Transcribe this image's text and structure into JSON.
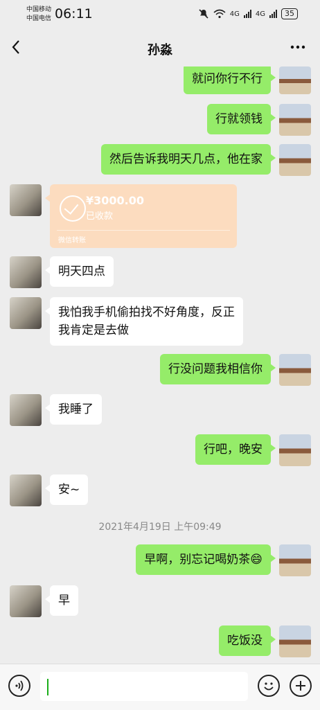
{
  "status_bar": {
    "carrier_1": "中国移动",
    "carrier_2": "中国电信",
    "time": "06:11",
    "net_1": "4G",
    "net_2": "4G",
    "battery": "35",
    "icons": [
      "mute-icon",
      "wifi-icon",
      "signal-icon",
      "battery-icon"
    ]
  },
  "header": {
    "title": "孙淼",
    "back_icon": "chevron-left-icon",
    "more_icon": "more-icon"
  },
  "messages": [
    {
      "from": "me",
      "text": "就问你行不行"
    },
    {
      "from": "me",
      "text": "行就领钱"
    },
    {
      "from": "me",
      "text": "然后告诉我明天几点，他在家"
    },
    {
      "from": "her",
      "type": "transfer",
      "amount": "¥3000.00",
      "status": "已收款",
      "label": "微信转账"
    },
    {
      "from": "her",
      "text": "明天四点"
    },
    {
      "from": "her",
      "text": "我怕我手机偷拍找不好角度，反正\n我肯定是去做"
    },
    {
      "from": "me",
      "text": "行没问题我相信你"
    },
    {
      "from": "her",
      "text": "我睡了"
    },
    {
      "from": "me",
      "text": "行吧，晚安"
    },
    {
      "from": "her",
      "text": "安~"
    },
    {
      "type": "timestamp",
      "text": "2021年4月19日 上午09:49"
    },
    {
      "from": "me",
      "text": "早啊，别忘记喝奶茶😄"
    },
    {
      "from": "her",
      "text": "早"
    },
    {
      "from": "me",
      "text": "吃饭没"
    }
  ],
  "input_bar": {
    "value": "",
    "icons": [
      "voice-icon",
      "emoji-icon",
      "plus-icon"
    ]
  }
}
